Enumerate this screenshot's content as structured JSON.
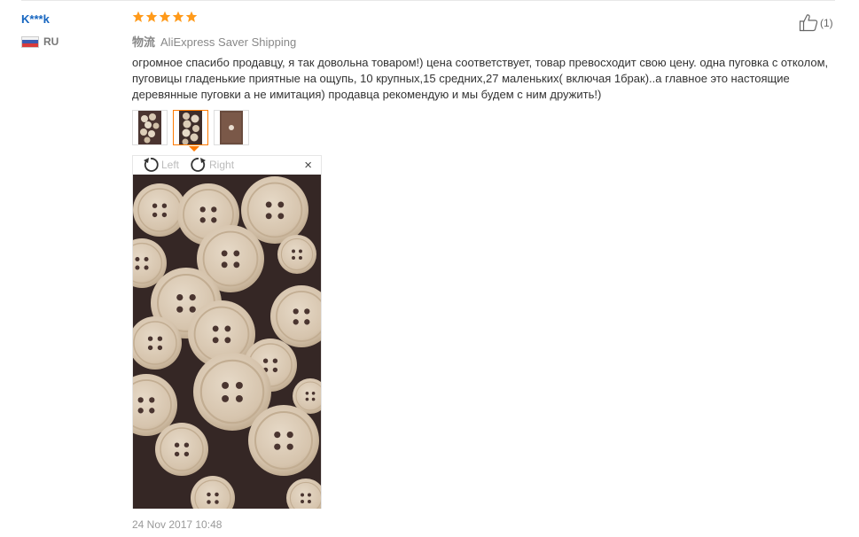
{
  "review": {
    "username": "K***k",
    "country_code": "RU",
    "rating": 5,
    "shipping_label": "物流",
    "shipping_method": "AliExpress Saver Shipping",
    "text": "огромное спасибо продавцу, я так довольна товаром!) цена соответствует, товар превосходит свою цену. одна пуговка с отколом, пуговицы гладенькие приятные на ощупь, 10 крупных,15 средних,27 маленьких( включая 1брак)..а главное это настоящие деревянные пуговки а не имитация) продавца рекомендую и мы будем с ним дружить!)",
    "date": "24 Nov 2017 10:48",
    "helpful_count": "(1)"
  },
  "viewer": {
    "rotate_left_label": "Left",
    "rotate_right_label": "Right",
    "close_glyph": "×",
    "active_thumbnail": 2,
    "thumbnail_count": 3
  },
  "colors": {
    "username": "#1565c0",
    "star": "#ff9a1a",
    "active_border": "#ff7a00",
    "photo_background": "#3b2b29",
    "button_wood": "#d9c8b4"
  },
  "icons": {
    "rotate_left": "rotate-left-icon",
    "rotate_right": "rotate-right-icon",
    "close": "close-icon",
    "thumb_up": "thumb-up-icon",
    "star": "star-icon",
    "flag": "russia-flag-icon"
  }
}
